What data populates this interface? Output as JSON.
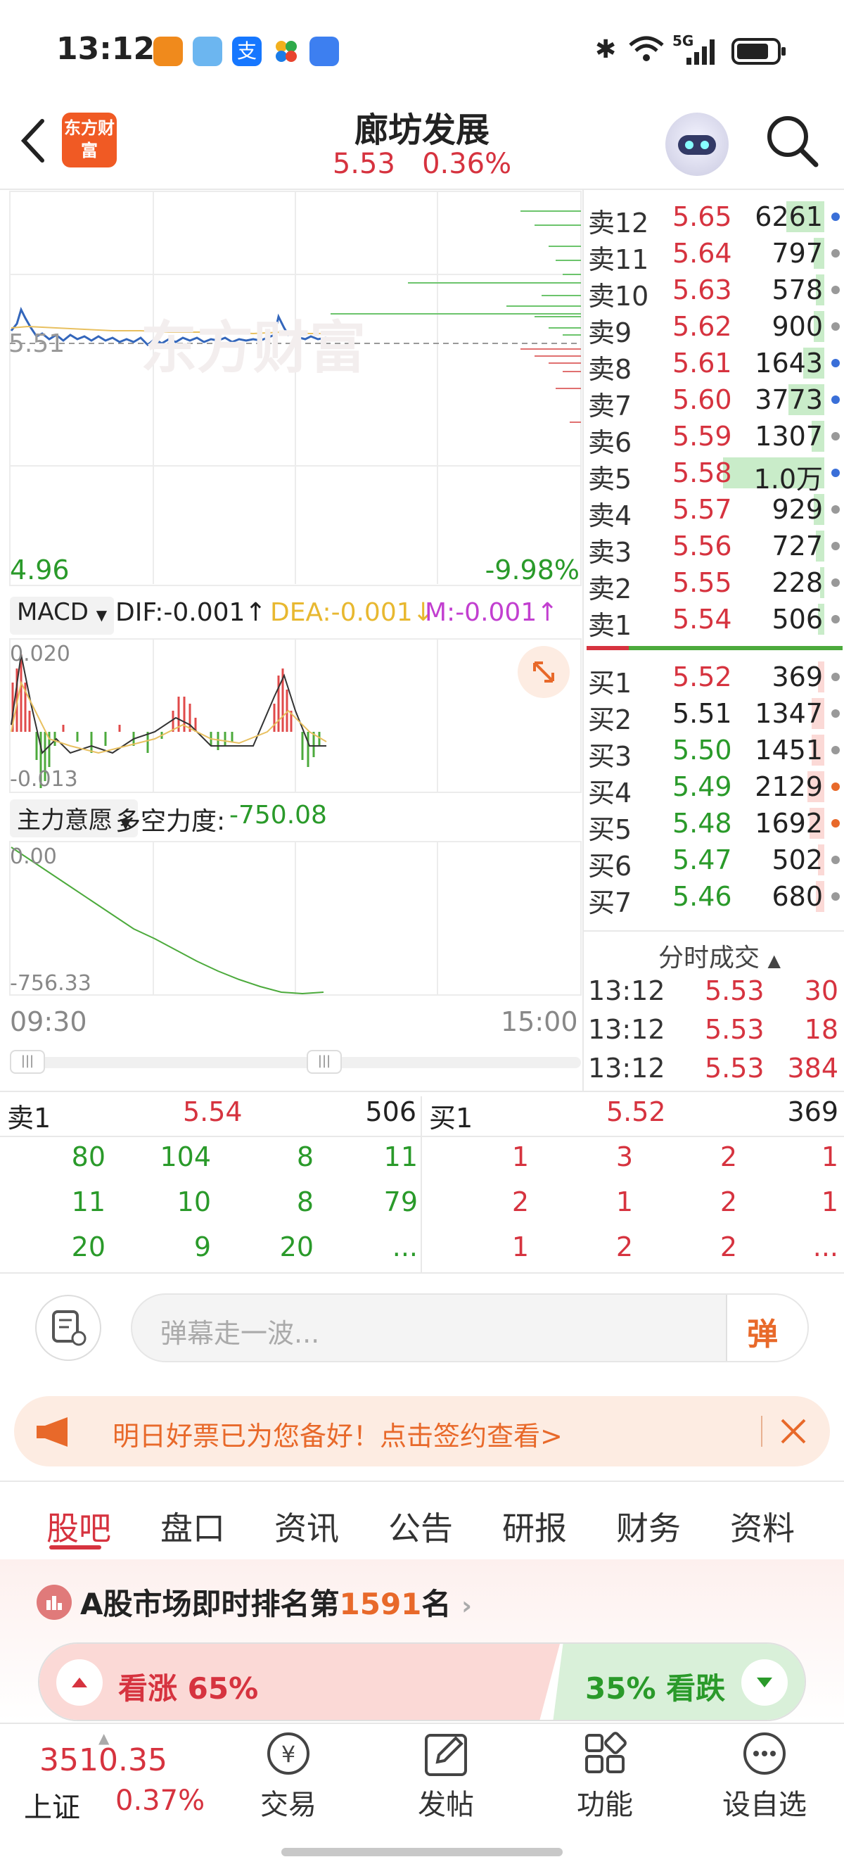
{
  "status_bar": {
    "time": "13:12",
    "net": "5G"
  },
  "header": {
    "title": "廊坊发展",
    "price": "5.53",
    "change": "0.36%",
    "logo_text": "东方财富"
  },
  "chart": {
    "price_ref": "5.51",
    "low_price": "4.96",
    "low_pct": "-9.98%",
    "watermark": "东方财富",
    "macd_selector": "MACD",
    "dif_label": "DIF:-0.001↑",
    "dea_label": "DEA:-0.001↓",
    "m_label": "M:-0.001↑",
    "macd_top": "0.020",
    "macd_bottom": "-0.013",
    "flow_selector": "主力意愿",
    "flow_label": "多空力度:",
    "flow_value": "-750.08",
    "flow_top": "0.00",
    "flow_bottom": "-756.33",
    "time_start": "09:30",
    "time_end": "15:00"
  },
  "order_book": {
    "sells": [
      {
        "label": "卖12",
        "price": "5.65",
        "vol": "6261",
        "bar": 0.18,
        "dot": "#3a6fd8"
      },
      {
        "label": "卖11",
        "price": "5.64",
        "vol": "797",
        "bar": 0.05,
        "dot": "#999999"
      },
      {
        "label": "卖10",
        "price": "5.63",
        "vol": "578",
        "bar": 0.04,
        "dot": "#999999"
      },
      {
        "label": "卖9",
        "price": "5.62",
        "vol": "900",
        "bar": 0.05,
        "dot": "#999999"
      },
      {
        "label": "卖8",
        "price": "5.61",
        "vol": "1643",
        "bar": 0.1,
        "dot": "#3a6fd8"
      },
      {
        "label": "卖7",
        "price": "5.60",
        "vol": "3773",
        "bar": 0.17,
        "dot": "#3a6fd8"
      },
      {
        "label": "卖6",
        "price": "5.59",
        "vol": "1307",
        "bar": 0.06,
        "dot": "#999999"
      },
      {
        "label": "卖5",
        "price": "5.58",
        "vol": "1.0万",
        "bar": 0.48,
        "dot": "#3a6fd8"
      },
      {
        "label": "卖4",
        "price": "5.57",
        "vol": "929",
        "bar": 0.05,
        "dot": "#999999"
      },
      {
        "label": "卖3",
        "price": "5.56",
        "vol": "727",
        "bar": 0.04,
        "dot": "#999999"
      },
      {
        "label": "卖2",
        "price": "5.55",
        "vol": "228",
        "bar": 0.02,
        "dot": "#999999"
      },
      {
        "label": "卖1",
        "price": "5.54",
        "vol": "506",
        "bar": 0.03,
        "dot": "#999999"
      }
    ],
    "buys": [
      {
        "label": "买1",
        "price": "5.52",
        "vol": "369",
        "bar": 0.03,
        "dot": "#999999"
      },
      {
        "label": "买2",
        "price": "5.51",
        "vol": "1347",
        "bar": 0.06,
        "dot": "#999999"
      },
      {
        "label": "买3",
        "price": "5.50",
        "vol": "1451",
        "bar": 0.06,
        "dot": "#999999"
      },
      {
        "label": "买4",
        "price": "5.49",
        "vol": "2129",
        "bar": 0.08,
        "dot": "#e8692a"
      },
      {
        "label": "买5",
        "price": "5.48",
        "vol": "1692",
        "bar": 0.07,
        "dot": "#e8692a"
      },
      {
        "label": "买6",
        "price": "5.47",
        "vol": "502",
        "bar": 0.03,
        "dot": "#999999"
      },
      {
        "label": "买7",
        "price": "5.46",
        "vol": "680",
        "bar": 0.04,
        "dot": "#999999"
      }
    ],
    "trades_title": "分时成交",
    "trades": [
      {
        "time": "13:12",
        "price": "5.53",
        "vol": "30"
      },
      {
        "time": "13:12",
        "price": "5.53",
        "vol": "18"
      },
      {
        "time": "13:12",
        "price": "5.53",
        "vol": "384"
      }
    ]
  },
  "level": {
    "sell_label": "卖1",
    "sell_price": "5.54",
    "sell_vol": "506",
    "buy_label": "买1",
    "buy_price": "5.52",
    "buy_vol": "369",
    "sell_rows": [
      [
        "80",
        "104",
        "8",
        "11"
      ],
      [
        "11",
        "10",
        "8",
        "79"
      ],
      [
        "20",
        "9",
        "20",
        "..."
      ]
    ],
    "buy_rows": [
      [
        "1",
        "3",
        "2",
        "1"
      ],
      [
        "2",
        "1",
        "2",
        "1"
      ],
      [
        "1",
        "2",
        "2",
        "..."
      ]
    ]
  },
  "comment": {
    "placeholder": "弹幕走一波...",
    "danmu_btn": "弹"
  },
  "banner": {
    "text": "明日好票已为您备好！点击签约查看>"
  },
  "tabs": [
    "股吧",
    "盘口",
    "资讯",
    "公告",
    "研报",
    "财务",
    "资料"
  ],
  "ranking": {
    "prefix": "A股市场即时排名第",
    "rank": "1591",
    "suffix": "名"
  },
  "sentiment": {
    "up_label": "看涨",
    "up_pct": "65%",
    "down_pct": "35%",
    "down_label": "看跌"
  },
  "bottom_nav": {
    "index_value": "3510.35",
    "index_name": "上证",
    "index_change": "0.37%",
    "trade": "交易",
    "post": "发帖",
    "func": "功能",
    "watch": "设自选"
  }
}
